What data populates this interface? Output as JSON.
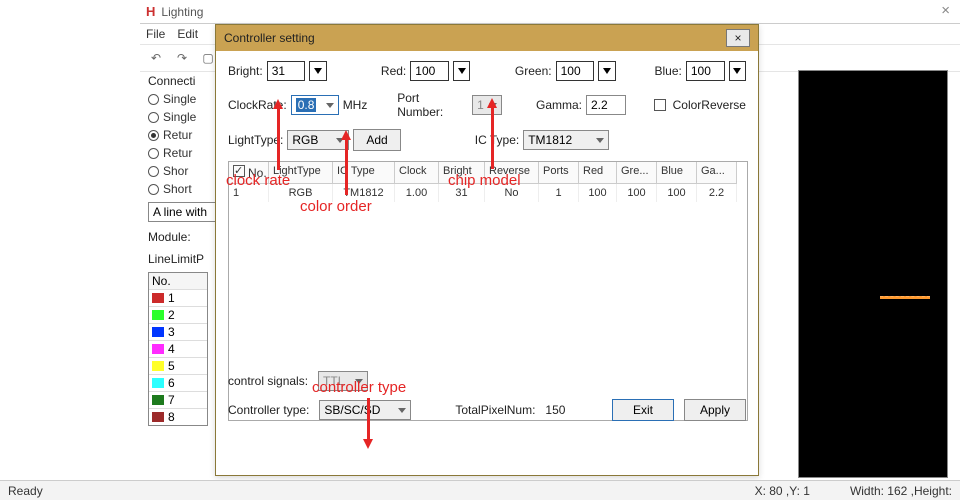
{
  "main_window": {
    "title": "Lighting",
    "menu": {
      "file": "File",
      "edit": "Edit"
    },
    "close": "×"
  },
  "left_panel": {
    "group_label": "Connecti",
    "radios": [
      "Single",
      "Single",
      "Retur",
      "Retur",
      "Shor",
      "Short"
    ],
    "selected_index": 2,
    "line_box": "A line with",
    "module_label": "Module:",
    "line_limit_label": "LineLimitP",
    "swatch_header": "No.",
    "swatches": [
      {
        "n": "1",
        "c": "#cc2a2a"
      },
      {
        "n": "2",
        "c": "#2bff2b"
      },
      {
        "n": "3",
        "c": "#0136ff"
      },
      {
        "n": "4",
        "c": "#ff2bff"
      },
      {
        "n": "5",
        "c": "#ffff2b"
      },
      {
        "n": "6",
        "c": "#2bffff"
      },
      {
        "n": "7",
        "c": "#1d7a1d"
      },
      {
        "n": "8",
        "c": "#9c2a2a"
      }
    ]
  },
  "dialog": {
    "title": "Controller setting",
    "close": "×",
    "labels": {
      "bright": "Bright:",
      "red": "Red:",
      "green": "Green:",
      "blue": "Blue:",
      "clockrate": "ClockRate:",
      "mhz": "MHz",
      "port_number": "Port Number:",
      "gamma": "Gamma:",
      "color_reverse": "ColorReverse",
      "light_type": "LightType:",
      "add": "Add",
      "ic_type": "IC Type:",
      "control_signals": "control signals:",
      "controller_type": "Controller type:",
      "total_pixel_num": "TotalPixelNum:",
      "exit": "Exit",
      "apply": "Apply"
    },
    "values": {
      "bright": "31",
      "red": "100",
      "green": "100",
      "blue": "100",
      "clockrate": "0.8",
      "port_number": "1",
      "gamma": "2.2",
      "light_type": "RGB",
      "ic_type": "TM1812",
      "control_signals": "TTL",
      "controller_type": "SB/SC/SD",
      "total_pixel_num": "150"
    },
    "table": {
      "headers": [
        "No.",
        "LightType",
        "IC Type",
        "Clock",
        "Bright",
        "Reverse",
        "Ports",
        "Red",
        "Gre...",
        "Blue",
        "Ga..."
      ],
      "rows": [
        [
          "1",
          "RGB",
          "TM1812",
          "1.00",
          "31",
          "No",
          "1",
          "100",
          "100",
          "100",
          "2.2"
        ]
      ]
    }
  },
  "annotations": {
    "clock_rate": "clock rate",
    "color_order": "color order",
    "chip_model": "chip model",
    "controller_type": "controller type"
  },
  "statusbar": {
    "ready": "Ready",
    "xy": "X: 80 ,Y: 1",
    "wh": "Width: 162 ,Height:"
  }
}
